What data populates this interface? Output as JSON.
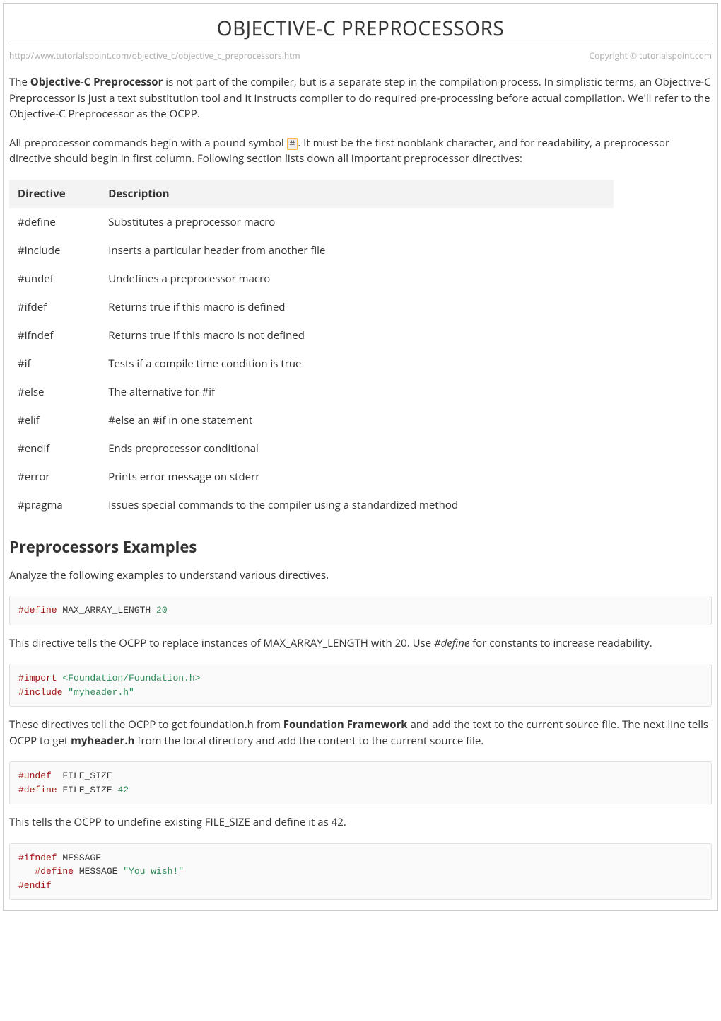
{
  "title": "OBJECTIVE-C PREPROCESSORS",
  "url": "http://www.tutorialspoint.com/objective_c/objective_c_preprocessors.htm",
  "copyright": "Copyright © tutorialspoint.com",
  "intro1_pre": "The ",
  "intro1_bold": "Objective-C Preprocessor",
  "intro1_post": " is not part of the compiler, but is a separate step in the compilation process. In simplistic terms, an Objective-C Preprocessor is just a text substitution tool and it instructs compiler to do required pre-processing before actual compilation. We'll refer to the Objective-C Preprocessor as the OCPP.",
  "intro2_pre": "All preprocessor commands begin with a pound symbol ",
  "intro2_code": "#",
  "intro2_post": ". It must be the first nonblank character, and for readability, a preprocessor directive should begin in first column. Following section lists down all important preprocessor directives:",
  "table": {
    "headers": {
      "c0": "Directive",
      "c1": "Description"
    },
    "rows": [
      {
        "c0": "#define",
        "c1": "Substitutes a preprocessor macro"
      },
      {
        "c0": "#include",
        "c1": "Inserts a particular header from another file"
      },
      {
        "c0": "#undef",
        "c1": "Undefines a preprocessor macro"
      },
      {
        "c0": "#ifdef",
        "c1": "Returns true if this macro is defined"
      },
      {
        "c0": "#ifndef",
        "c1": "Returns true if this macro is not defined"
      },
      {
        "c0": "#if",
        "c1": "Tests if a compile time condition is true"
      },
      {
        "c0": "#else",
        "c1": "The alternative for #if"
      },
      {
        "c0": "#elif",
        "c1": "#else an #if in one statement"
      },
      {
        "c0": "#endif",
        "c1": "Ends preprocessor conditional"
      },
      {
        "c0": "#error",
        "c1": "Prints error message on stderr"
      },
      {
        "c0": "#pragma",
        "c1": "Issues special commands to the compiler using a standardized method"
      }
    ]
  },
  "section_examples": "Preprocessors Examples",
  "examples_intro": "Analyze the following examples to understand various directives.",
  "code1": {
    "t0": "#define",
    "t1": " MAX_ARRAY_LENGTH ",
    "t2": "20"
  },
  "after_code1_pre": "This directive tells the OCPP to replace instances of MAX_ARRAY_LENGTH with 20. Use ",
  "after_code1_italic": "#define",
  "after_code1_post": " for constants to increase readability.",
  "code2": {
    "l1a": "#import",
    "l1b": " ",
    "l1c": "<Foundation/Foundation.h>",
    "l2a": "#include",
    "l2b": " ",
    "l2c": "\"myheader.h\""
  },
  "after_code2_a": "These directives tell the OCPP to get foundation.h from ",
  "after_code2_b": "Foundation Framework",
  "after_code2_c": " and add the text to the current source file. The next line tells OCPP to get ",
  "after_code2_d": "myheader.h",
  "after_code2_e": " from the local directory and add the content to the current source file.",
  "code3": {
    "l1a": "#undef",
    "l1b": "  FILE_SIZE",
    "l2a": "#define",
    "l2b": " FILE_SIZE ",
    "l2c": "42"
  },
  "after_code3": "This tells the OCPP to undefine existing FILE_SIZE and define it as 42.",
  "code4": {
    "l1a": "#ifndef",
    "l1b": " MESSAGE",
    "l2a": "   #define",
    "l2b": " MESSAGE ",
    "l2c": "\"You wish!\"",
    "l3a": "#endif"
  }
}
